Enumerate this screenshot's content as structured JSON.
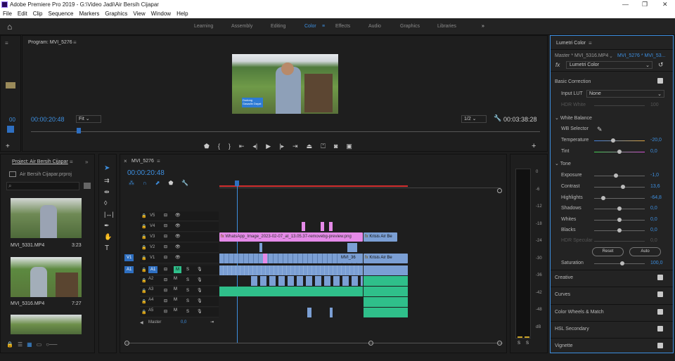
{
  "window": {
    "title": "Adobe Premiere Pro 2019 - G:\\Video Jadi\\Air Bersih Cijapar",
    "minimize": "—",
    "maximize": "❐",
    "close": "✕"
  },
  "menu": [
    "File",
    "Edit",
    "Clip",
    "Sequence",
    "Markers",
    "Graphics",
    "View",
    "Window",
    "Help"
  ],
  "workspaces": [
    "Learning",
    "Assembly",
    "Editing",
    "Color",
    "Effects",
    "Audio",
    "Graphics",
    "Libraries"
  ],
  "workspace_active": "Color",
  "program": {
    "title": "Program: MVI_5276",
    "timecode": "00:00:20:48",
    "fit": "Fit",
    "scale": "1/2",
    "duration": "00:03:38:28",
    "left_timecode": "00",
    "overlay_text": "Dodong Gasadin Dayat"
  },
  "project": {
    "title": "Project: Air Bersih Cijapar",
    "file": "Air Bersih Cijapar.prproj",
    "clips": [
      {
        "name": "MVI_5331.MP4",
        "duration": "3:23"
      },
      {
        "name": "MVI_5316.MP4",
        "duration": "7:27"
      },
      {
        "name": "",
        "duration": ""
      }
    ]
  },
  "timeline": {
    "title": "MVI_5276",
    "timecode": "00:00:20:48",
    "video_tracks": [
      "V5",
      "V4",
      "V3",
      "V2",
      "V1"
    ],
    "audio_tracks": [
      "A1",
      "A2",
      "A3",
      "A4",
      "A5"
    ],
    "master_label": "Master",
    "master_value": "0,0",
    "clip_v3": "WhatsApp_Image_2023-02-07_at_13.05.37-removebg-preview.png",
    "clip_v3b": "Krisis Air Be",
    "clip_v1": "MVI_36",
    "clip_v1b": "Krisis Air Be",
    "m_label": "M",
    "s_label": "S",
    "src_v1": "V1",
    "src_a1": "A1"
  },
  "meter": {
    "scale": [
      "0",
      "-6",
      "-12",
      "-18",
      "-24",
      "-30",
      "-36",
      "-42",
      "-48",
      "dB"
    ],
    "solo": [
      "S",
      "S"
    ]
  },
  "lumetri": {
    "title": "Lumetri Color",
    "master": "Master * MVI_5316.MP4",
    "sequence": "MVI_5276 * MVI_53...",
    "fx": "fx",
    "effect": "Lumetri Color",
    "basic": "Basic Correction",
    "input_lut_label": "Input LUT",
    "input_lut_value": "None",
    "hdr_white": "HDR White",
    "hdr_white_value": "100",
    "white_balance": "White Balance",
    "wb_selector": "WB Selector",
    "tone": "Tone",
    "params": [
      {
        "name": "Temperature",
        "value": "-20,0",
        "pos": 0.38
      },
      {
        "name": "Tint",
        "value": "0,0",
        "pos": 0.5
      },
      {
        "name": "Exposure",
        "value": "-1,0",
        "pos": 0.43
      },
      {
        "name": "Contrast",
        "value": "13,6",
        "pos": 0.57
      },
      {
        "name": "Highlights",
        "value": "-64,8",
        "pos": 0.18
      },
      {
        "name": "Shadows",
        "value": "0,0",
        "pos": 0.5
      },
      {
        "name": "Whites",
        "value": "0,0",
        "pos": 0.5
      },
      {
        "name": "Blacks",
        "value": "0,0",
        "pos": 0.5
      }
    ],
    "hdr_specular": "HDR Specular",
    "hdr_specular_value": "0,0",
    "reset": "Reset",
    "auto": "Auto",
    "saturation": "Saturation",
    "saturation_value": "100,0",
    "sections": [
      "Creative",
      "Curves",
      "Color Wheels & Match",
      "HSL Secondary",
      "Vignette"
    ]
  },
  "colors": {
    "accent": "#3d8fe0",
    "pink": "#e58ae8",
    "blue_clip": "#7b9fd4",
    "green_audio": "#2fbf8a",
    "red_bar": "#d32f2f"
  }
}
